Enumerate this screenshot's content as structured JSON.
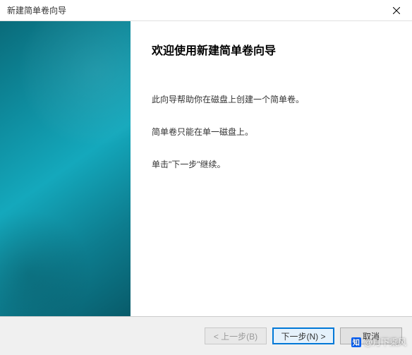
{
  "titlebar": {
    "title": "新建简单卷向导"
  },
  "main": {
    "heading": "欢迎使用新建简单卷向导",
    "para1": "此向导帮助你在磁盘上创建一个简单卷。",
    "para2": "简单卷只能在单一磁盘上。",
    "para3": "单击\"下一步\"继续。"
  },
  "footer": {
    "back": "< 上一步(B)",
    "next": "下一步(N) >",
    "cancel": "取消"
  },
  "watermark": {
    "icon": "知",
    "text": "@月下乘风"
  }
}
